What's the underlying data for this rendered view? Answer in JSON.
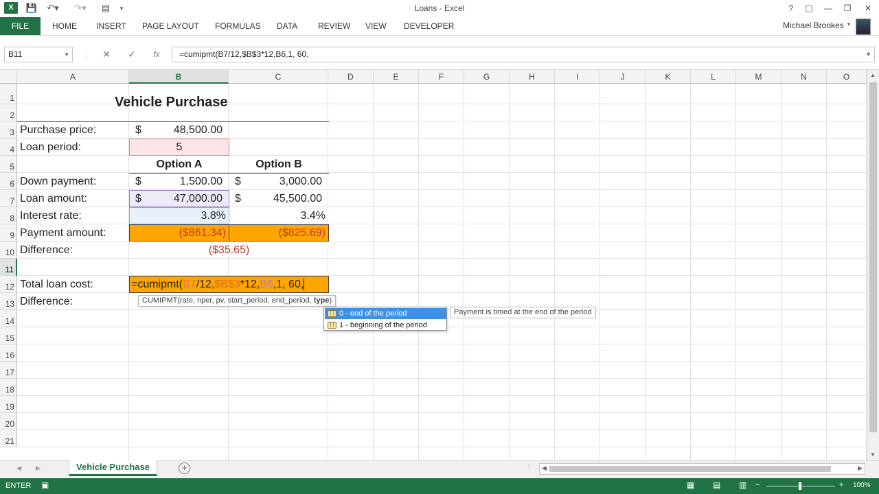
{
  "window": {
    "title": "Loans - Excel",
    "controls": [
      "?",
      "▢",
      "—",
      "❐",
      "✕"
    ]
  },
  "ribbon": {
    "tabs": [
      "FILE",
      "HOME",
      "INSERT",
      "PAGE LAYOUT",
      "FORMULAS",
      "DATA",
      "REVIEW",
      "VIEW",
      "DEVELOPER"
    ],
    "user": "Michael Brookes"
  },
  "formula_bar": {
    "name_box": "B11",
    "cancel": "✕",
    "enter": "✓",
    "fx": "fx",
    "formula": "=cumipmt(B7/12,$B$3*12,B6,1, 60,"
  },
  "columns": [
    "A",
    "B",
    "C",
    "D",
    "E",
    "F",
    "G",
    "H",
    "I",
    "J",
    "K",
    "L",
    "M",
    "N",
    "O"
  ],
  "rows": [
    "1",
    "2",
    "3",
    "4",
    "5",
    "6",
    "7",
    "8",
    "9",
    "10",
    "11",
    "12",
    "13",
    "14",
    "15",
    "16",
    "17",
    "18",
    "19",
    "20",
    "21"
  ],
  "sheet": {
    "title": "Vehicle Purchase",
    "purchase_price_label": "Purchase price:",
    "purchase_price_cur": "$",
    "purchase_price": "48,500.00",
    "loan_period_label": "Loan period:",
    "loan_period": "5",
    "option_a": "Option A",
    "option_b": "Option B",
    "down_payment_label": "Down payment:",
    "down_a_cur": "$",
    "down_a": "1,500.00",
    "down_b_cur": "$",
    "down_b": "3,000.00",
    "loan_amount_label": "Loan amount:",
    "loan_a_cur": "$",
    "loan_a": "47,000.00",
    "loan_b_cur": "$",
    "loan_b": "45,500.00",
    "interest_label": "Interest rate:",
    "interest_a": "3.8%",
    "interest_b": "3.4%",
    "payment_label": "Payment amount:",
    "payment_a": "($861.34)",
    "payment_b": "($825.69)",
    "difference_label": "Difference:",
    "difference": "($35.65)",
    "total_cost_label": "Total loan cost:",
    "difference2_label": "Difference:",
    "edit_formula": {
      "prefix": "=cumipmt(",
      "ref1": "B7",
      "part2": "/12,",
      "ref2": "$B$3",
      "part3": "*12,",
      "ref3": "B6",
      "suffix": ",1, 60,"
    }
  },
  "tooltip": {
    "signature": "CUMIPMT(rate, nper, pv, start_period, end_period, ",
    "signature_bold": "type",
    "signature_end": ")"
  },
  "autocomplete": {
    "items": [
      "0 - end of the period",
      "1 - beginning of the period"
    ],
    "description": "Payment is timed at the end of the period"
  },
  "sheet_tabs": {
    "active": "Vehicle Purchase",
    "add": "+"
  },
  "status": {
    "mode": "ENTER",
    "zoom": "100%"
  },
  "colors": {
    "excel_green": "#217346",
    "payment_fill": "#ffa500",
    "negative_text": "#c0392b",
    "ref_b7": "#e07b39",
    "ref_b3": "#e07b39",
    "ref_b6": "#b07cc6"
  }
}
